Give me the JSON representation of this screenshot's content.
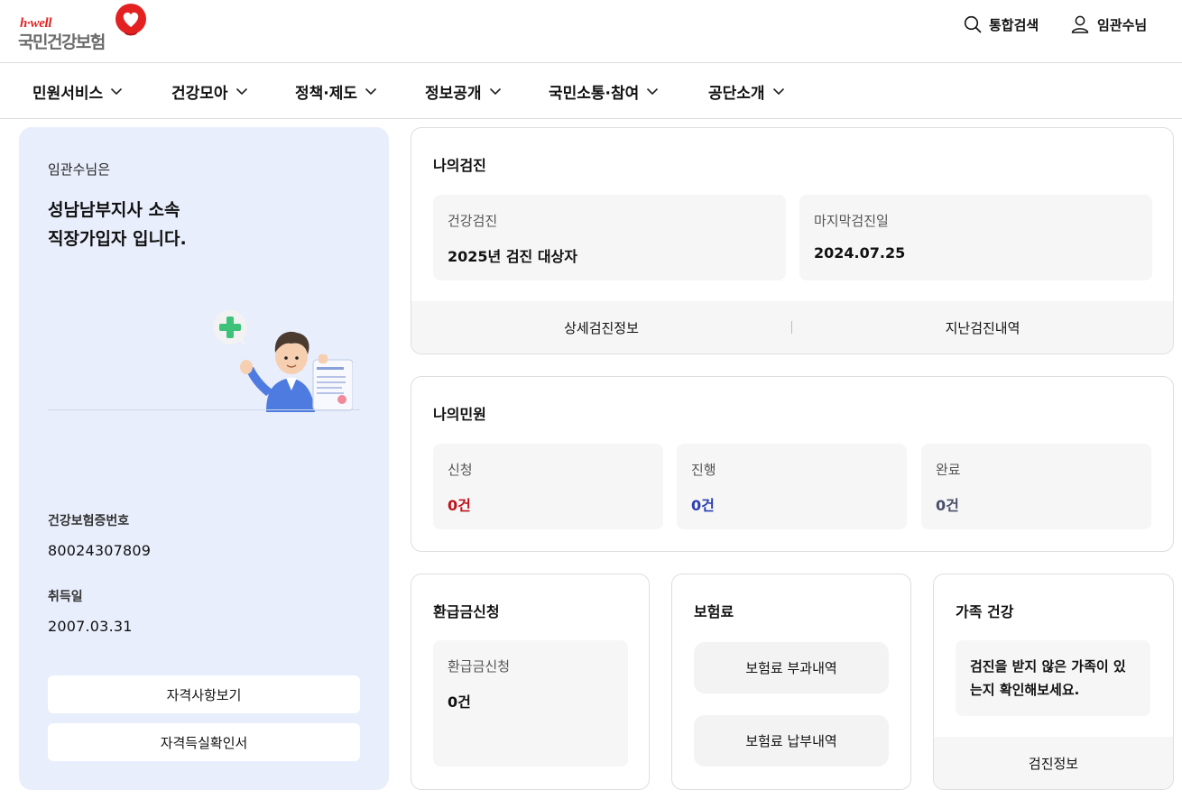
{
  "header": {
    "logo_tagline": "h·well",
    "logo_name": "국민건강보험",
    "search_label": "통합검색",
    "user_label": "임관수님",
    "icons": {
      "search": "search-icon",
      "user": "user-icon",
      "logo": "heart-logo-icon"
    },
    "brand_color": "#e32121"
  },
  "nav": {
    "items": [
      {
        "label": "민원서비스"
      },
      {
        "label": "건강모아"
      },
      {
        "label": "정책·제도"
      },
      {
        "label": "정보공개"
      },
      {
        "label": "국민소통·참여"
      },
      {
        "label": "공단소개"
      }
    ]
  },
  "profile": {
    "greeting": "임관수님은",
    "title_line1": "성남남부지사 소속",
    "title_line2": "직장가입자 입니다.",
    "insurance_no_label": "건강보험증번호",
    "insurance_no": "80024307809",
    "acquired_label": "취득일",
    "acquired_date": "2007.03.31",
    "btn_eligibility": "자격사항보기",
    "btn_certificate": "자격득실확인서",
    "illustration": "man-holding-insurance-document",
    "panel_color": "#e8eefc"
  },
  "checkup": {
    "title": "나의검진",
    "tiles": [
      {
        "label": "건강검진",
        "value": "2025년 검진 대상자"
      },
      {
        "label": "마지막검진일",
        "value": "2024.07.25"
      }
    ],
    "links": [
      "상세검진정보",
      "지난검진내역"
    ]
  },
  "complaints": {
    "title": "나의민원",
    "tiles": [
      {
        "label": "신청",
        "value": "0건",
        "color": "#c0121b"
      },
      {
        "label": "진행",
        "value": "0건",
        "color": "#2b3fb5"
      },
      {
        "label": "완료",
        "value": "0건",
        "color": "#4a4f6a"
      }
    ]
  },
  "refund": {
    "title": "환급금신청",
    "tile_label": "환급금신청",
    "tile_value": "0건"
  },
  "premium": {
    "title": "보험료",
    "btn_charge": "보험료 부과내역",
    "btn_payment": "보험료 납부내역"
  },
  "family": {
    "title": "가족 건강",
    "message_line1": "검진을 받지 않은 가족이 있",
    "message_line2": "는지 확인해보세요.",
    "link": "검진정보"
  }
}
